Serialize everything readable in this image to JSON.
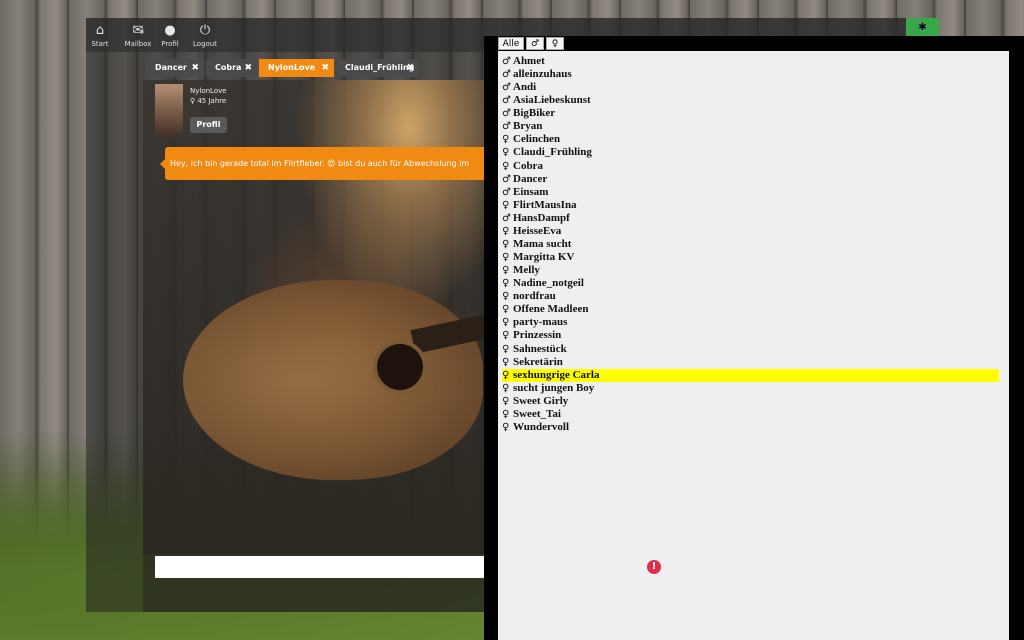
{
  "menu": [
    {
      "label": "Start",
      "icon": "home-icon",
      "glyph": "⌂"
    },
    {
      "label": "Mailbox",
      "icon": "mail-icon",
      "glyph": "✉",
      "count": "0"
    },
    {
      "label": "Profil",
      "icon": "user-icon",
      "glyph": "●"
    },
    {
      "label": "Logout",
      "icon": "power-icon",
      "glyph": "⏻"
    }
  ],
  "top_right_button": {
    "icon": "paw-icon",
    "glyph": "✱",
    "color": "#3aa64a"
  },
  "tabs": [
    {
      "label": "Dancer",
      "active": false
    },
    {
      "label": "Cobra",
      "active": false
    },
    {
      "label": "NylonLove",
      "active": true
    },
    {
      "label": "Claudi_Frühling",
      "active": false
    }
  ],
  "tab_close_glyph": "✖",
  "profile": {
    "name": "NylonLove",
    "age": "♀ 45 Jahre",
    "button": "Profil"
  },
  "message": {
    "text": "Hey, ich bin gerade total im Flirtfieber. 😍 bist du auch für Abwechslung im",
    "color": "#f08a12"
  },
  "chat_input": {
    "value": "",
    "placeholder": ""
  },
  "filters": [
    {
      "label": "Alle"
    },
    {
      "label": "♂"
    },
    {
      "label": "♀"
    }
  ],
  "users": [
    {
      "g": "♂",
      "name": "Ahmet"
    },
    {
      "g": "♂",
      "name": "alleinzuhaus"
    },
    {
      "g": "♂",
      "name": "Andi"
    },
    {
      "g": "♂",
      "name": "AsiaLiebeskunst"
    },
    {
      "g": "♂",
      "name": "BigBiker"
    },
    {
      "g": "♂",
      "name": "Bryan"
    },
    {
      "g": "♀",
      "name": "Celinchen"
    },
    {
      "g": "♀",
      "name": "Claudi_Frühling"
    },
    {
      "g": "♀",
      "name": "Cobra"
    },
    {
      "g": "♂",
      "name": "Dancer"
    },
    {
      "g": "♂",
      "name": "Einsam"
    },
    {
      "g": "♀",
      "name": "FlirtMausIna"
    },
    {
      "g": "♂",
      "name": "HansDampf"
    },
    {
      "g": "♀",
      "name": "HeisseEva"
    },
    {
      "g": "♀",
      "name": "Mama sucht"
    },
    {
      "g": "♀",
      "name": "Margitta KV"
    },
    {
      "g": "♀",
      "name": "Melly"
    },
    {
      "g": "♀",
      "name": "Nadine_notgeil"
    },
    {
      "g": "♀",
      "name": "nordfrau"
    },
    {
      "g": "♀",
      "name": "Offene Madleen"
    },
    {
      "g": "♀",
      "name": "party-maus"
    },
    {
      "g": "♀",
      "name": "Prinzessin"
    },
    {
      "g": "♀",
      "name": "Sahnestück"
    },
    {
      "g": "♀",
      "name": "Sekretärin"
    },
    {
      "g": "♀",
      "name": "sexhungrige Carla",
      "highlight": true
    },
    {
      "g": "♀",
      "name": "sucht jungen Boy"
    },
    {
      "g": "♀",
      "name": "Sweet Girly"
    },
    {
      "g": "♀",
      "name": "Sweet_Tai"
    },
    {
      "g": "♀",
      "name": "Wundervoll"
    }
  ],
  "highlight_color": "#ffff00",
  "warning": {
    "icon": "alert-icon",
    "glyph": "!"
  }
}
